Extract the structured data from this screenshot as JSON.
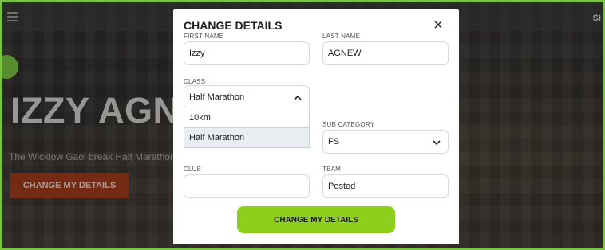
{
  "background": {
    "hero_title": "IZZY AGNE",
    "hero_subtitle": "The Wicklow Gaol break Half Marathon &",
    "hero_button": "CHANGE MY DETAILS",
    "corner_text": "SI",
    "accent_color": "#7cc242"
  },
  "modal": {
    "title": "CHANGE DETAILS",
    "close_icon": "close-icon",
    "first_name": {
      "label": "FIRST NAME",
      "value": "Izzy"
    },
    "last_name": {
      "label": "LAST NAME",
      "value": "AGNEW"
    },
    "class": {
      "label": "CLASS",
      "value": "Half Marathon",
      "options": [
        "10km",
        "Half Marathon"
      ],
      "selected": "Half Marathon"
    },
    "sub_category": {
      "label": "SUB CATEGORY",
      "value": "FS"
    },
    "club": {
      "label": "CLUB",
      "value": ""
    },
    "team": {
      "label": "TEAM",
      "value": "Posted"
    },
    "submit_label": "CHANGE MY DETAILS",
    "submit_color": "#8ecf1d"
  }
}
